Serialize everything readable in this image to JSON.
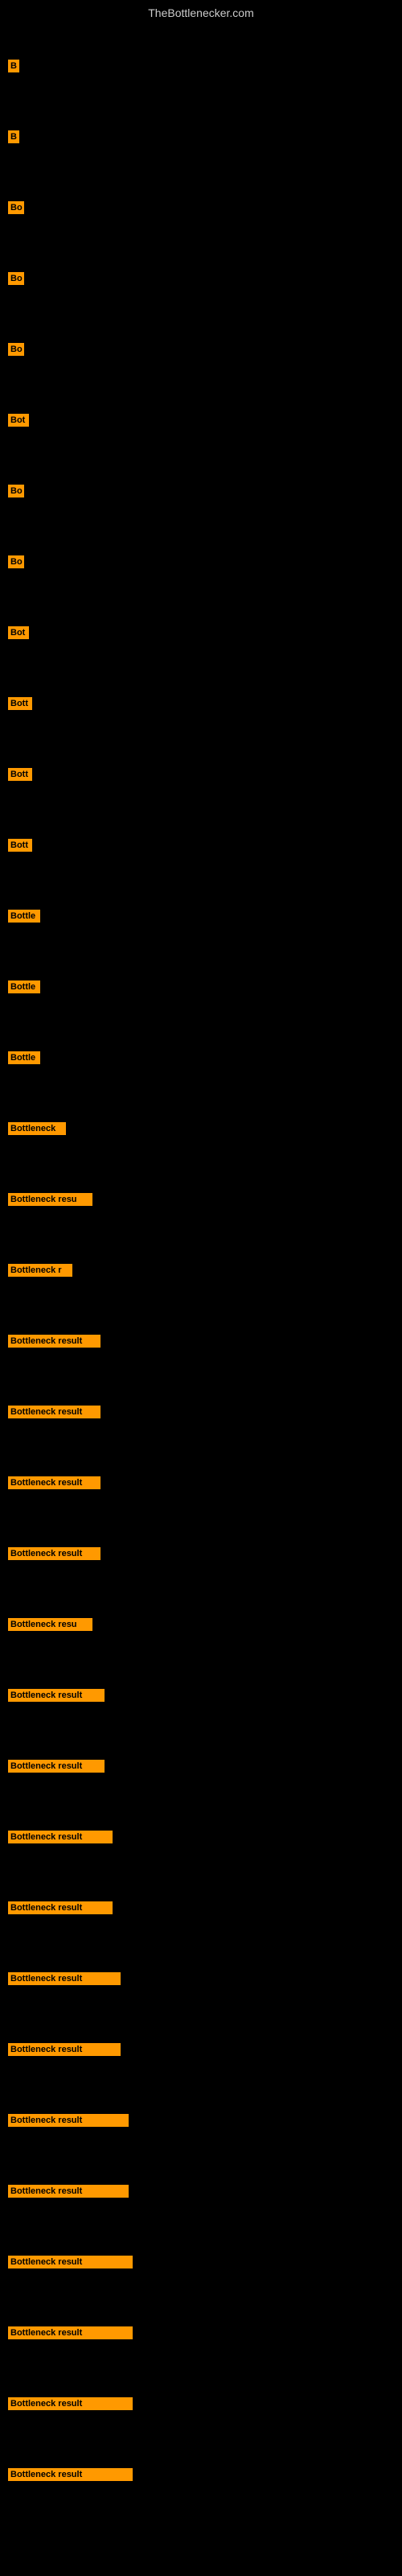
{
  "header": {
    "title": "TheBottlenecker.com"
  },
  "bars": [
    {
      "id": 1,
      "label": "B",
      "width": 14
    },
    {
      "id": 2,
      "label": "B",
      "width": 14
    },
    {
      "id": 3,
      "label": "Bo",
      "width": 20
    },
    {
      "id": 4,
      "label": "Bo",
      "width": 20
    },
    {
      "id": 5,
      "label": "Bo",
      "width": 20
    },
    {
      "id": 6,
      "label": "Bot",
      "width": 26
    },
    {
      "id": 7,
      "label": "Bo",
      "width": 20
    },
    {
      "id": 8,
      "label": "Bo",
      "width": 20
    },
    {
      "id": 9,
      "label": "Bot",
      "width": 26
    },
    {
      "id": 10,
      "label": "Bott",
      "width": 30
    },
    {
      "id": 11,
      "label": "Bott",
      "width": 30
    },
    {
      "id": 12,
      "label": "Bott",
      "width": 30
    },
    {
      "id": 13,
      "label": "Bottle",
      "width": 40
    },
    {
      "id": 14,
      "label": "Bottle",
      "width": 40
    },
    {
      "id": 15,
      "label": "Bottle",
      "width": 40
    },
    {
      "id": 16,
      "label": "Bottleneck",
      "width": 72
    },
    {
      "id": 17,
      "label": "Bottleneck resu",
      "width": 105
    },
    {
      "id": 18,
      "label": "Bottleneck r",
      "width": 80
    },
    {
      "id": 19,
      "label": "Bottleneck result",
      "width": 115
    },
    {
      "id": 20,
      "label": "Bottleneck result",
      "width": 115
    },
    {
      "id": 21,
      "label": "Bottleneck result",
      "width": 115
    },
    {
      "id": 22,
      "label": "Bottleneck result",
      "width": 115
    },
    {
      "id": 23,
      "label": "Bottleneck resu",
      "width": 105
    },
    {
      "id": 24,
      "label": "Bottleneck result",
      "width": 120
    },
    {
      "id": 25,
      "label": "Bottleneck result",
      "width": 120
    },
    {
      "id": 26,
      "label": "Bottleneck result",
      "width": 130
    },
    {
      "id": 27,
      "label": "Bottleneck result",
      "width": 130
    },
    {
      "id": 28,
      "label": "Bottleneck result",
      "width": 140
    },
    {
      "id": 29,
      "label": "Bottleneck result",
      "width": 140
    },
    {
      "id": 30,
      "label": "Bottleneck result",
      "width": 150
    },
    {
      "id": 31,
      "label": "Bottleneck result",
      "width": 150
    },
    {
      "id": 32,
      "label": "Bottleneck result",
      "width": 155
    },
    {
      "id": 33,
      "label": "Bottleneck result",
      "width": 155
    },
    {
      "id": 34,
      "label": "Bottleneck result",
      "width": 155
    },
    {
      "id": 35,
      "label": "Bottleneck result",
      "width": 155
    }
  ]
}
